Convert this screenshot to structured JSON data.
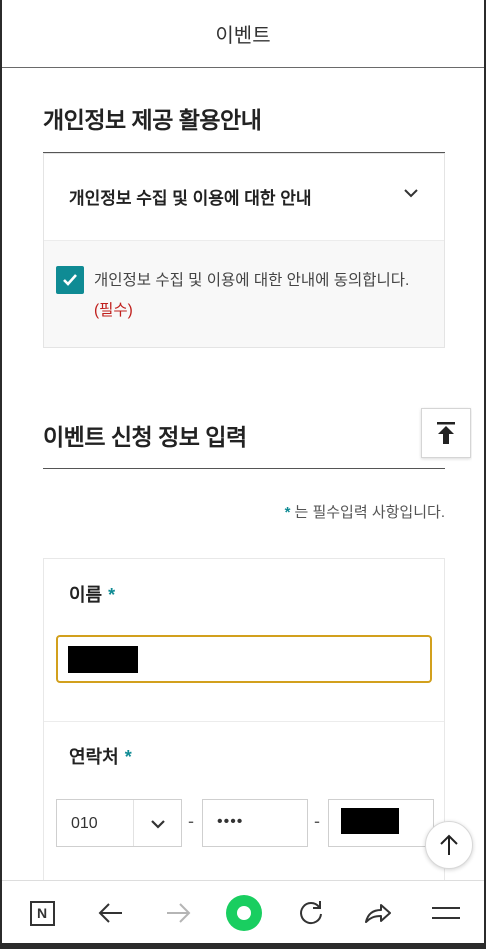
{
  "header": {
    "title": "이벤트"
  },
  "privacy": {
    "section_title": "개인정보 제공 활용안내",
    "accordion_label": "개인정보 수집 및 이용에 대한 안내",
    "accordion_icon": "chevron-down-icon",
    "agree_text": "개인정보 수집 및 이용에 대한 안내에 동의합니다.",
    "required_text": "(필수)",
    "agree_checked": true
  },
  "form": {
    "section_title": "이벤트 신청 정보 입력",
    "required_star": "*",
    "required_note": "는 필수입력 사항입니다.",
    "name_label": "이름",
    "phone_label": "연락처",
    "phone_prefix": "010",
    "phone_middle": "••••",
    "phone_separator": "-"
  },
  "buttons": {
    "scroll_top_icon": "scroll-to-top-icon",
    "float_up_icon": "arrow-up-icon"
  },
  "bottom_nav": {
    "n_label": "N",
    "items": [
      "naver-home",
      "back",
      "forward",
      "green-dot",
      "reload",
      "share",
      "menu"
    ]
  },
  "colors": {
    "accent": "#0f8b94",
    "required_red": "#c0201d",
    "focus_border": "#d2a01d",
    "green": "#19ce60"
  }
}
